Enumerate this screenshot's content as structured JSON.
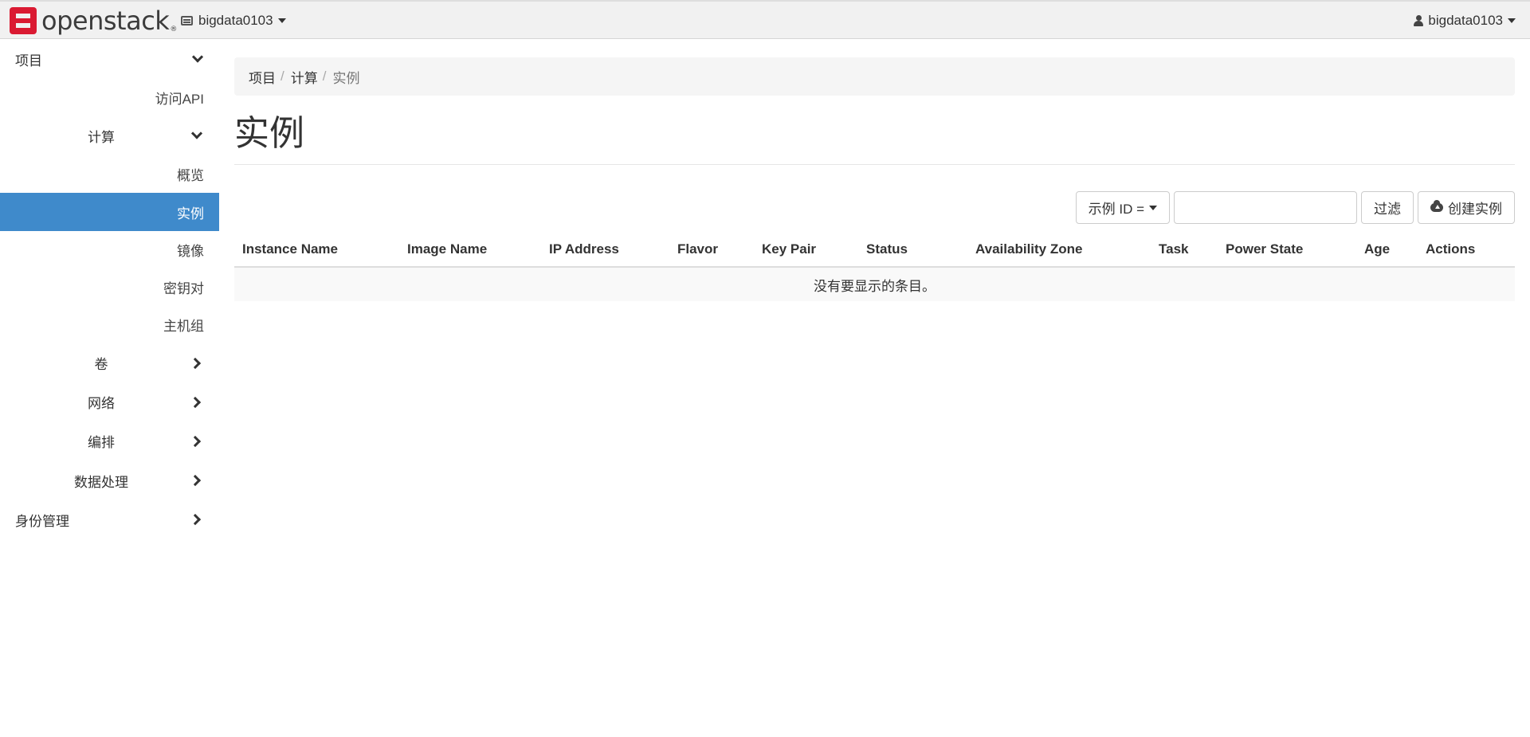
{
  "navbar": {
    "logo_text": "openstack",
    "logo_mark": "®",
    "project": "bigdata0103",
    "user": "bigdata0103"
  },
  "sidebar": {
    "project": "项目",
    "access_api": "访问API",
    "compute": "计算",
    "overview": "概览",
    "instances": "实例",
    "images": "镜像",
    "keypairs": "密钥对",
    "server_groups": "主机组",
    "volumes": "卷",
    "network": "网络",
    "orchestration": "编排",
    "data_processing": "数据处理",
    "identity": "身份管理"
  },
  "breadcrumb": {
    "item1": "项目",
    "item2": "计算",
    "current": "实例",
    "separator": "/"
  },
  "page": {
    "title": "实例"
  },
  "toolbar": {
    "filter_field": "示例 ID =",
    "filter_value": "",
    "filter_button": "过滤",
    "create_button": "创建实例"
  },
  "table": {
    "columns": [
      "Instance Name",
      "Image Name",
      "IP Address",
      "Flavor",
      "Key Pair",
      "Status",
      "Availability Zone",
      "Task",
      "Power State",
      "Age",
      "Actions"
    ],
    "empty_message": "没有要显示的条目。"
  }
}
